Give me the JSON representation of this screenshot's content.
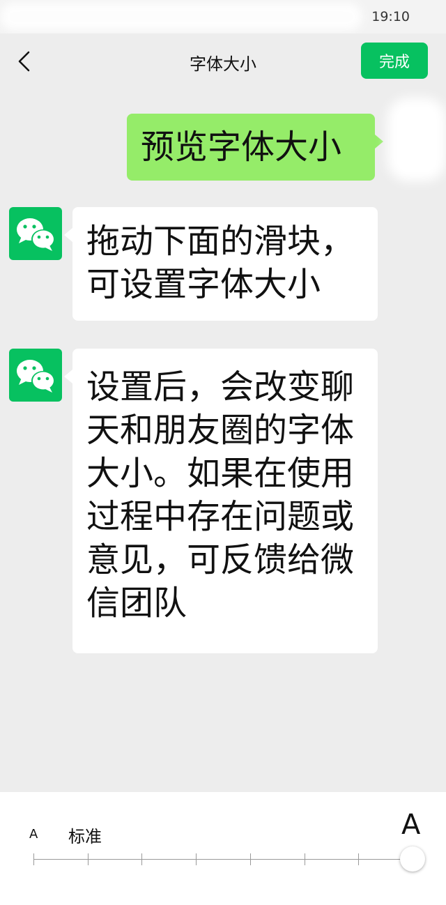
{
  "status_bar": {
    "time": "19:10"
  },
  "nav": {
    "back_icon": "chevron-left-icon",
    "title": "字体大小",
    "done_label": "完成"
  },
  "colors": {
    "accent": "#07c160",
    "my_bubble": "#95ec69",
    "background": "#ededed"
  },
  "messages": [
    {
      "from": "me",
      "text": "预览字体大小"
    },
    {
      "from": "other",
      "avatar_icon": "wechat-logo-icon",
      "text": "拖动下面的滑块，\n可设置字体大小"
    },
    {
      "from": "other",
      "avatar_icon": "wechat-logo-icon",
      "text": "设置后，会改变聊\n天和朋友圈的字体\n大小。如果在使用\n过程中存在问题或\n意见，可反馈给微\n信团队"
    }
  ],
  "font_slider": {
    "small_label": "A",
    "standard_label": "标准",
    "large_label": "A",
    "steps": 8,
    "selected_step": 7
  }
}
